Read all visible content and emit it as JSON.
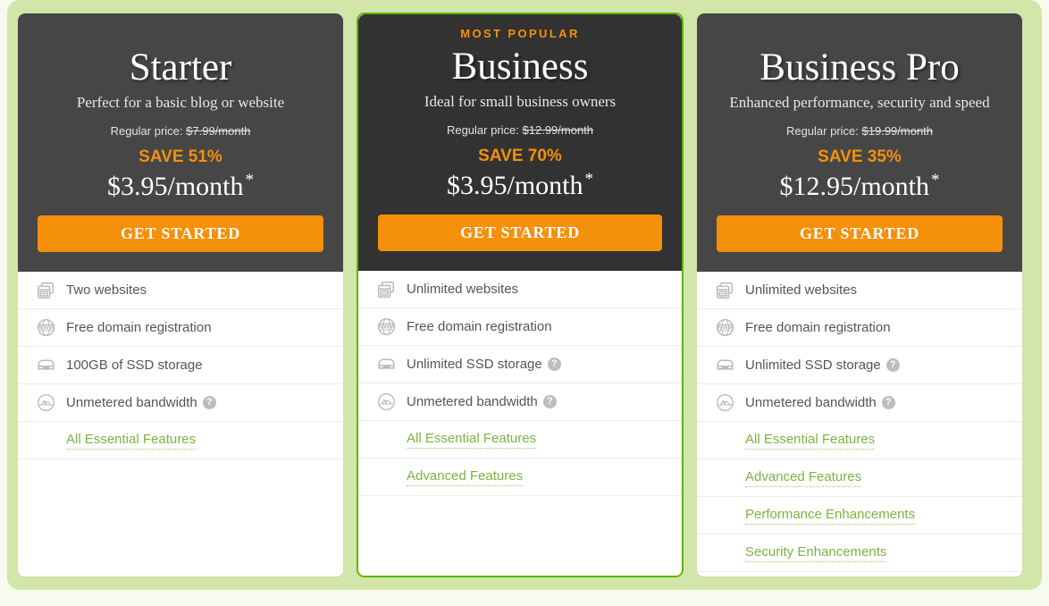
{
  "colors": {
    "panel_bg": "#d3e6a9",
    "page_bg": "#f7fbef",
    "card_header": "#464646",
    "card_header_featured": "#323232",
    "accent_orange": "#f5900a",
    "featured_border": "#5cb500",
    "link_green": "#7cb342"
  },
  "plans": [
    {
      "badge": "",
      "name": "Starter",
      "tagline": "Perfect for a basic blog or website",
      "regular_label": "Regular price:",
      "regular_price": "$7.99/month",
      "save": "SAVE 51%",
      "price": "$3.95/month",
      "price_star": "*",
      "cta": "GET STARTED",
      "featured": false,
      "features": [
        {
          "icon": "websites-icon",
          "text": "Two websites",
          "help": false
        },
        {
          "icon": "globe-www-icon",
          "text": "Free domain registration",
          "help": false
        },
        {
          "icon": "ssd-storage-icon",
          "text": "100GB of SSD storage",
          "help": false
        },
        {
          "icon": "bandwidth-gauge-icon",
          "text": "Unmetered bandwidth",
          "help": true
        }
      ],
      "links": [
        "All Essential Features"
      ]
    },
    {
      "badge": "MOST POPULAR",
      "name": "Business",
      "tagline": "Ideal for small business owners",
      "regular_label": "Regular price:",
      "regular_price": "$12.99/month",
      "save": "SAVE 70%",
      "price": "$3.95/month",
      "price_star": "*",
      "cta": "GET STARTED",
      "featured": true,
      "features": [
        {
          "icon": "websites-icon",
          "text": "Unlimited websites",
          "help": false
        },
        {
          "icon": "globe-www-icon",
          "text": "Free domain registration",
          "help": false
        },
        {
          "icon": "ssd-storage-icon",
          "text": "Unlimited SSD storage",
          "help": true
        },
        {
          "icon": "bandwidth-gauge-icon",
          "text": "Unmetered bandwidth",
          "help": true
        }
      ],
      "links": [
        "All Essential Features",
        "Advanced Features"
      ]
    },
    {
      "badge": "",
      "name": "Business Pro",
      "tagline": "Enhanced performance, security and speed",
      "regular_label": "Regular price:",
      "regular_price": "$19.99/month",
      "save": "SAVE 35%",
      "price": "$12.95/month",
      "price_star": "*",
      "cta": "GET STARTED",
      "featured": false,
      "features": [
        {
          "icon": "websites-icon",
          "text": "Unlimited websites",
          "help": false
        },
        {
          "icon": "globe-www-icon",
          "text": "Free domain registration",
          "help": false
        },
        {
          "icon": "ssd-storage-icon",
          "text": "Unlimited SSD storage",
          "help": true
        },
        {
          "icon": "bandwidth-gauge-icon",
          "text": "Unmetered bandwidth",
          "help": true
        }
      ],
      "links": [
        "All Essential Features",
        "Advanced Features",
        "Performance Enhancements",
        "Security Enhancements"
      ]
    }
  ],
  "help_glyph": "?"
}
